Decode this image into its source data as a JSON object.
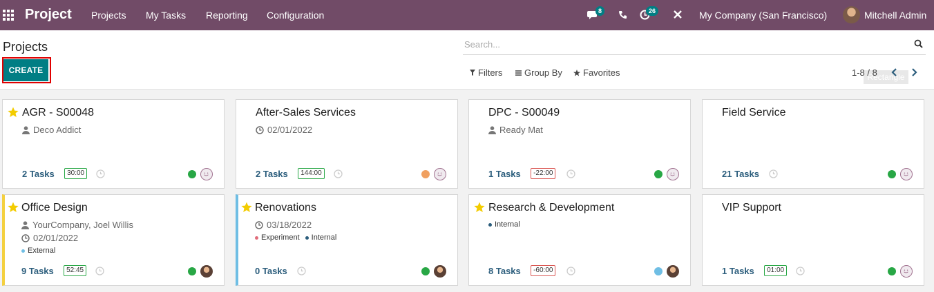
{
  "nav": {
    "app_name": "Project",
    "menu": [
      "Projects",
      "My Tasks",
      "Reporting",
      "Configuration"
    ],
    "messages_count": "8",
    "activities_count": "26",
    "company": "My Company (San Francisco)",
    "user": "Mitchell Admin"
  },
  "control": {
    "title": "Projects",
    "create_label": "CREATE",
    "search_placeholder": "Search...",
    "filters_label": "Filters",
    "groupby_label": "Group By",
    "favorites_label": "Favorites",
    "pager": "1-8 / 8",
    "pager_tooltip": "Rectangle"
  },
  "colors": {
    "brand": "#714b67",
    "accent": "#017e84",
    "green": "#28a745",
    "orange": "#f0a060",
    "blue": "#6fbee4",
    "yellow": "#f4d03f"
  },
  "projects": [
    {
      "name": "AGR - S00048",
      "favorite": true,
      "customer": "Deco Addict",
      "date": "",
      "tags": [],
      "task_count": "2",
      "task_word": "Tasks",
      "time": "30:00",
      "time_negative": false,
      "status": "green",
      "avatar": "smile"
    },
    {
      "name": "After-Sales Services",
      "favorite": false,
      "customer": "",
      "date": "02/01/2022",
      "tags": [],
      "task_count": "2",
      "task_word": "Tasks",
      "time": "144:00",
      "time_negative": false,
      "status": "orange",
      "avatar": "smile"
    },
    {
      "name": "DPC - S00049",
      "favorite": false,
      "customer": "Ready Mat",
      "date": "",
      "tags": [],
      "task_count": "1",
      "task_word": "Tasks",
      "time": "-22:00",
      "time_negative": true,
      "status": "green",
      "avatar": "smile"
    },
    {
      "name": "Field Service",
      "favorite": false,
      "customer": "",
      "date": "",
      "tags": [],
      "task_count": "21",
      "task_word": "Tasks",
      "time": "",
      "time_negative": false,
      "status": "green",
      "avatar": "smile"
    },
    {
      "name": "Office Design",
      "favorite": true,
      "customer": "YourCompany, Joel Willis",
      "date": "02/01/2022",
      "tags": [
        {
          "label": "External",
          "color": "#6fbee4"
        }
      ],
      "task_count": "9",
      "task_word": "Tasks",
      "time": "52:45",
      "time_negative": false,
      "status": "green",
      "avatar": "photo"
    },
    {
      "name": "Renovations",
      "favorite": true,
      "customer": "",
      "date": "03/18/2022",
      "tags": [
        {
          "label": "Experiment",
          "color": "#e06c7a"
        },
        {
          "label": "Internal",
          "color": "#2b5d7c"
        }
      ],
      "task_count": "0",
      "task_word": "Tasks",
      "time": "",
      "time_negative": false,
      "status": "green",
      "avatar": "photo"
    },
    {
      "name": "Research & Development",
      "favorite": true,
      "customer": "",
      "date": "",
      "tags": [
        {
          "label": "Internal",
          "color": "#2b5d7c"
        }
      ],
      "task_count": "8",
      "task_word": "Tasks",
      "time": "-60:00",
      "time_negative": true,
      "status": "blue",
      "avatar": "photo"
    },
    {
      "name": "VIP Support",
      "favorite": false,
      "customer": "",
      "date": "",
      "tags": [],
      "task_count": "1",
      "task_word": "Tasks",
      "time": "01:00",
      "time_negative": false,
      "status": "green",
      "avatar": "smile"
    }
  ]
}
